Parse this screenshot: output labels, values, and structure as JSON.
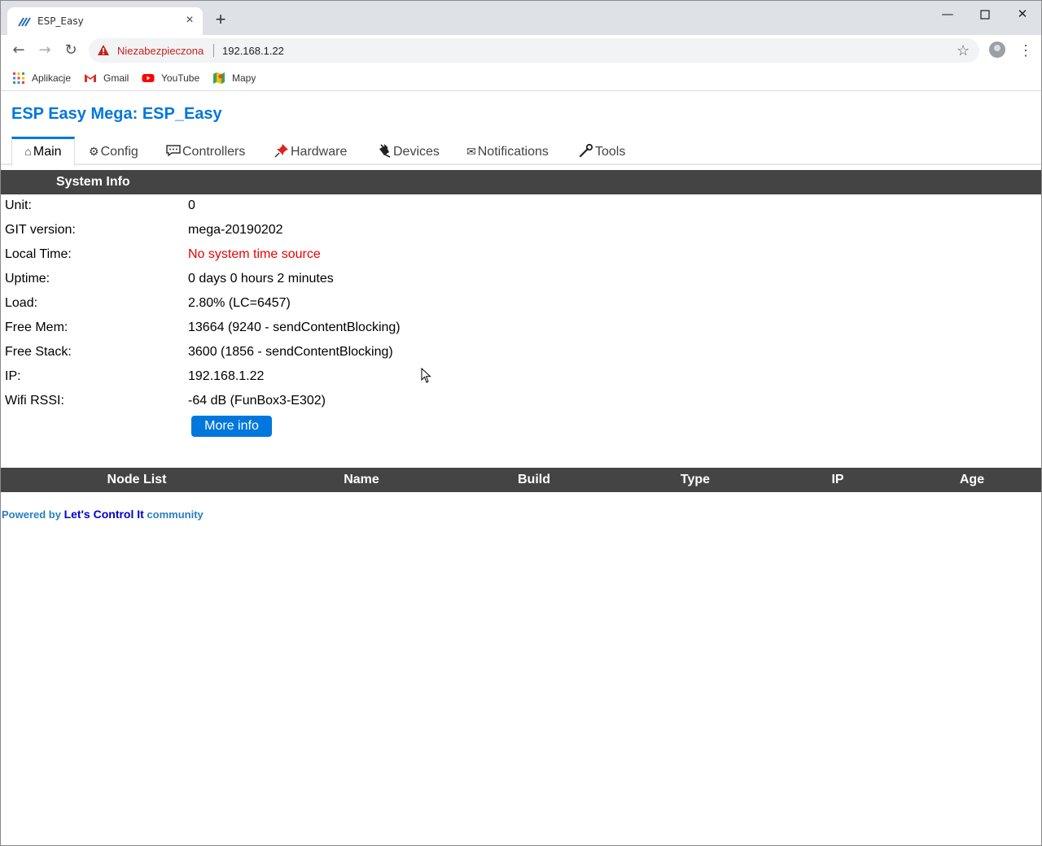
{
  "browser": {
    "tab_title": "ESP_Easy",
    "security_label": "Niezabezpieczona",
    "url": "192.168.1.22",
    "bookmarks": [
      {
        "label": "Aplikacje",
        "icon": "apps-grid-icon"
      },
      {
        "label": "Gmail",
        "icon": "gmail-icon"
      },
      {
        "label": "YouTube",
        "icon": "youtube-icon"
      },
      {
        "label": "Mapy",
        "icon": "maps-icon"
      }
    ]
  },
  "app": {
    "title": "ESP Easy Mega: ESP_Easy",
    "menu": [
      {
        "label": "Main",
        "icon": "home-icon",
        "glyph": "⌂",
        "active": true
      },
      {
        "label": "Config",
        "icon": "gear-icon",
        "glyph": "⚙",
        "active": false
      },
      {
        "label": "Controllers",
        "icon": "speech-bubble-icon",
        "glyph": "💬",
        "active": false
      },
      {
        "label": "Hardware",
        "icon": "pushpin-icon",
        "glyph": "📌",
        "active": false
      },
      {
        "label": "Devices",
        "icon": "plug-icon",
        "glyph": "🔌",
        "active": false
      },
      {
        "label": "Notifications",
        "icon": "envelope-icon",
        "glyph": "✉",
        "active": false
      },
      {
        "label": "Tools",
        "icon": "wrench-icon",
        "glyph": "🔧",
        "active": false
      }
    ]
  },
  "system_info": {
    "header": "System Info",
    "rows": [
      {
        "label": "Unit:",
        "value": "0"
      },
      {
        "label": "GIT version:",
        "value": "mega-20190202"
      },
      {
        "label": "Local Time:",
        "value": "No system time source"
      },
      {
        "label": "Uptime:",
        "value": "0 days 0 hours 2 minutes"
      },
      {
        "label": "Load:",
        "value": "2.80% (LC=6457)"
      },
      {
        "label": "Free Mem:",
        "value": "13664 (9240 - sendContentBlocking)"
      },
      {
        "label": "Free Stack:",
        "value": "3600 (1856 - sendContentBlocking)"
      },
      {
        "label": "IP:",
        "value": "192.168.1.22"
      },
      {
        "label": "Wifi RSSI:",
        "value": "-64 dB (FunBox3-E302)"
      }
    ],
    "more_info_label": "More info",
    "warning_color": "#ee0000"
  },
  "node_list": {
    "columns": [
      "Node List",
      "Name",
      "Build",
      "Type",
      "IP",
      "Age"
    ]
  },
  "footer": {
    "prefix": "Powered by",
    "link": "Let's Control It",
    "suffix": "community"
  },
  "colors": {
    "accent": "#0077dd",
    "header_bg": "#444444"
  }
}
